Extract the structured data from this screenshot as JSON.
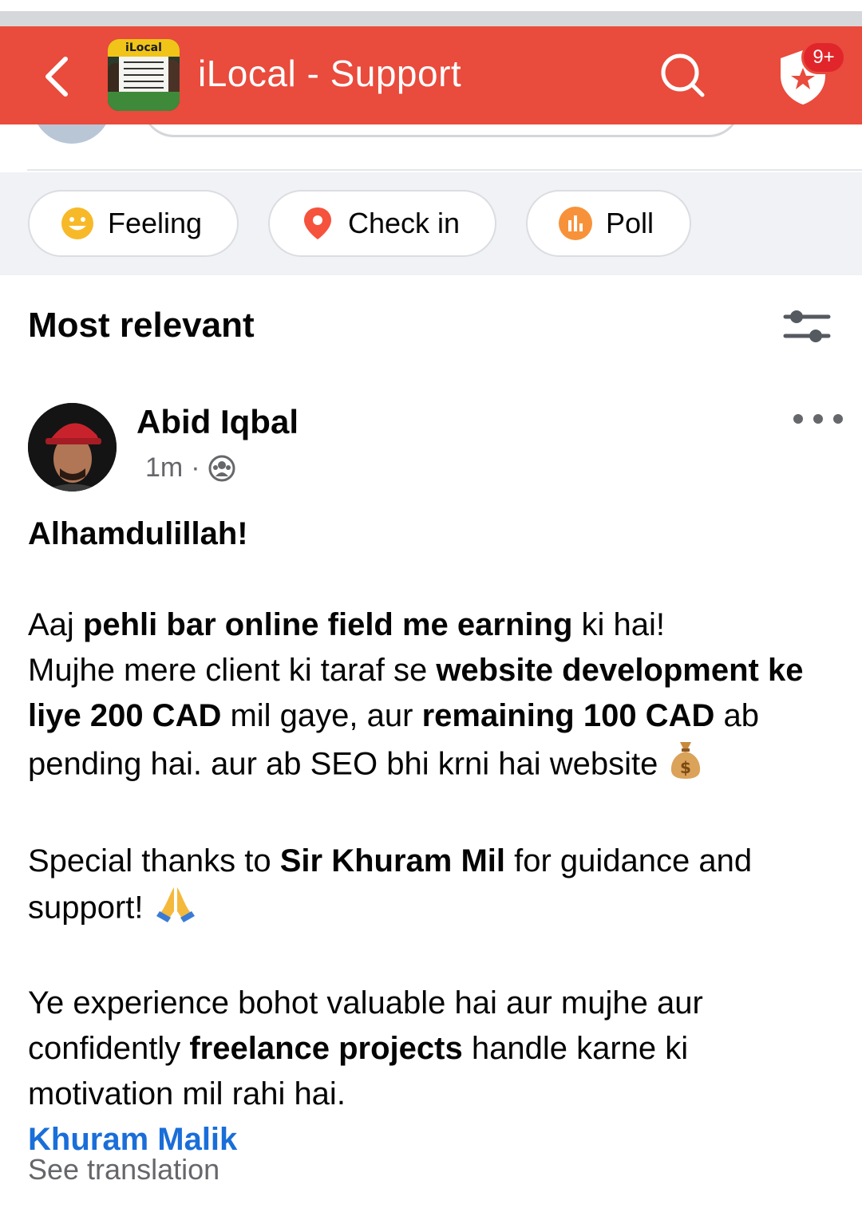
{
  "header": {
    "title": "iLocal - Support",
    "badge_count": "9+",
    "thumbnail_brand": "iLocal",
    "background_color": "#e94b3c"
  },
  "composer": {
    "chips": [
      {
        "label": "Feeling",
        "icon": "smiley-icon"
      },
      {
        "label": "Check in",
        "icon": "location-pin-icon"
      },
      {
        "label": "Poll",
        "icon": "poll-icon"
      }
    ]
  },
  "sort": {
    "title": "Most relevant",
    "icon": "filter-sliders-icon"
  },
  "post": {
    "author": "Abid Iqbal",
    "time": "1m",
    "separator": "·",
    "audience_icon": "group-audience-icon",
    "heading": "Alhamdulillah!",
    "p1_a": "Aaj ",
    "p1_b": "pehli bar online field me earning",
    "p1_c": " ki hai!",
    "p2_a": "Mujhe mere client ki taraf se ",
    "p2_b": "website development ke liye 200 CAD",
    "p2_c": " mil gaye, aur ",
    "p2_d": "remaining 100 CAD",
    "p2_e": " ab pending hai. aur ab SEO bhi krni hai website",
    "p3_a": "Special thanks to ",
    "p3_b": "Sir Khuram Mil",
    "p3_c": " for guidance and support!",
    "p4_a": "Ye experience bohot valuable hai aur mujhe aur confidently ",
    "p4_b": "freelance projects",
    "p4_c": " handle karne ki motivation mil rahi hai.",
    "mention": "Khuram Malik",
    "see_translation": "See translation",
    "accent_link_color": "#1a6ed8"
  }
}
